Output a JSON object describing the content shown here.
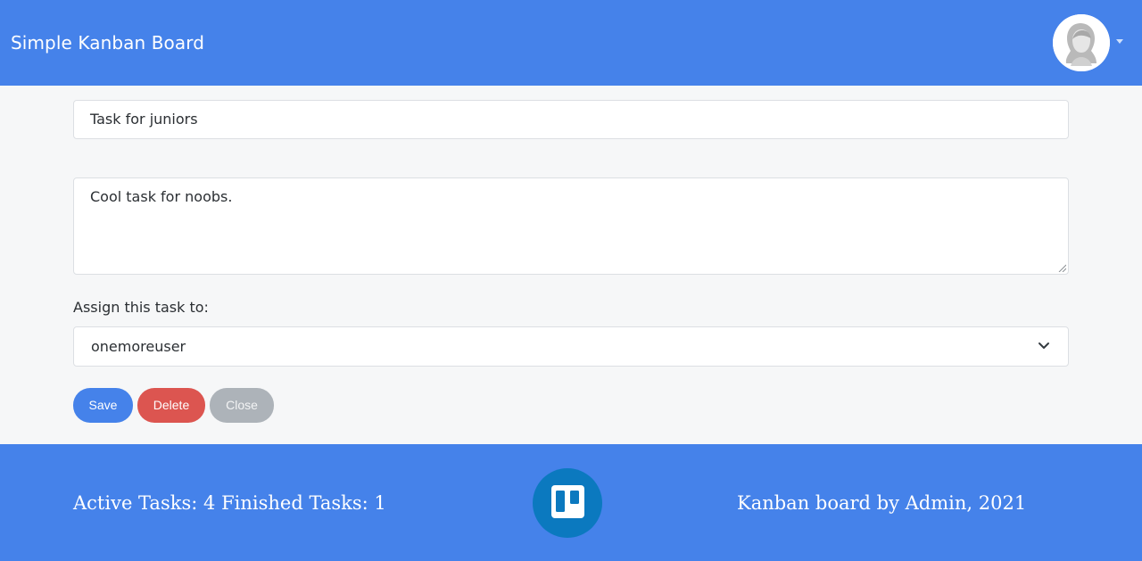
{
  "app": {
    "brand": "Simple Kanban Board"
  },
  "navbar": {
    "avatar_icon": "user-avatar",
    "menu_icon": "caret-down-icon"
  },
  "form": {
    "title_value": "Task for juniors",
    "description_value": "Cool task for noobs.",
    "assign_label": "Assign this task to:",
    "assignee_selected": "onemoreuser",
    "buttons": {
      "save": "Save",
      "delete": "Delete",
      "close": "Close"
    }
  },
  "footer": {
    "active_label": "Active Tasks:",
    "active_count": "4",
    "finished_label": "Finished Tasks:",
    "finished_count": "1",
    "credit": "Kanban board by Admin, 2021",
    "logo_icon": "trello-icon"
  },
  "colors": {
    "primary": "#4582ea",
    "danger": "#dc5550",
    "secondary": "#adb3b9",
    "logo_bg": "#0b79bf"
  }
}
